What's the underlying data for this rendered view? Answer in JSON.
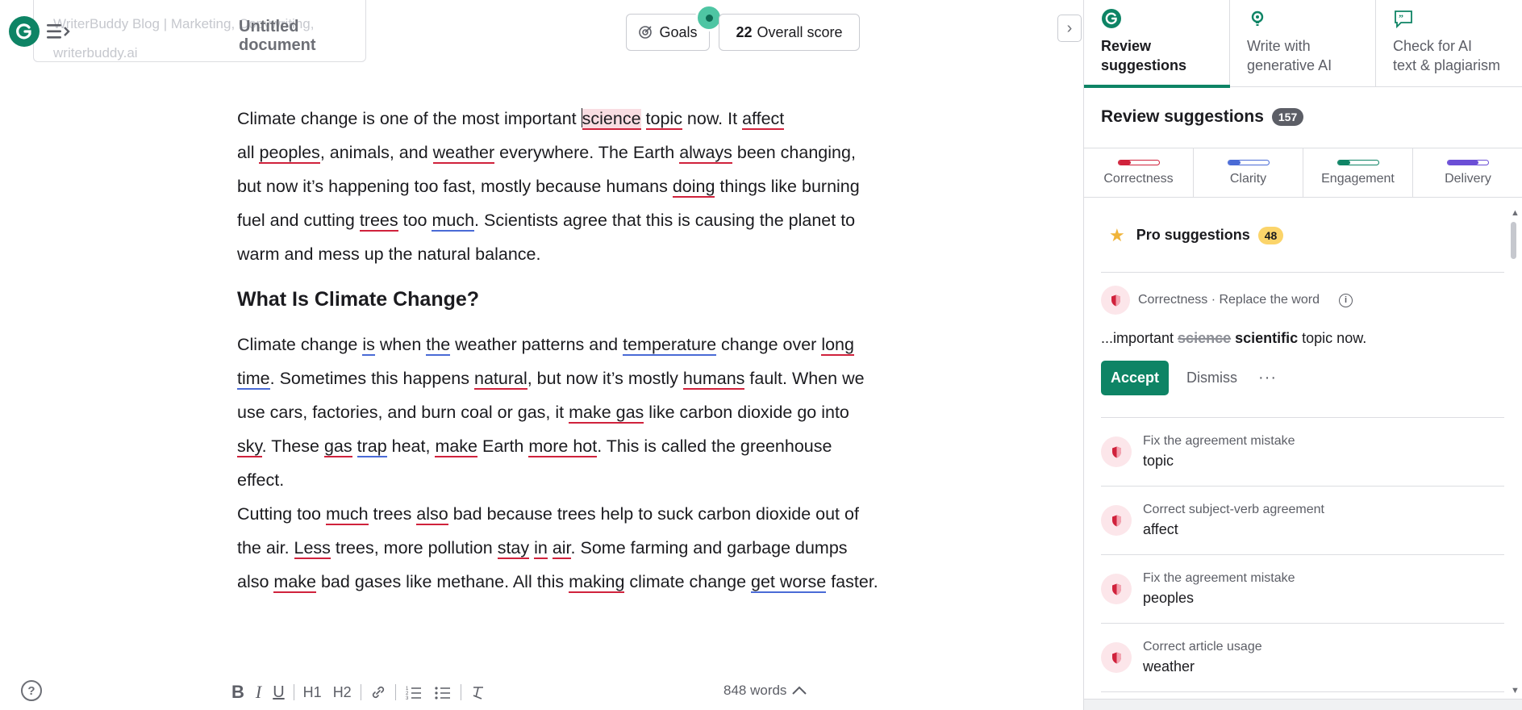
{
  "editor": {
    "doc_card_ghost_text": "WriterBuddy Blog | Marketing, Copywriting, writerbuddy.ai",
    "doc_title": "Untitled document",
    "goals_label": "Goals",
    "score_value": "22",
    "score_label": "Overall score",
    "word_count": "848 words"
  },
  "content": {
    "p1": {
      "a": "Climate change is one of the most important ",
      "science": "science",
      "topic": "topic",
      "b": " now. It ",
      "affect": "affect",
      "c": "all ",
      "peoples": "peoples",
      "d": ", animals, and ",
      "weather": "weather",
      "e": " everywhere. The Earth ",
      "always": "always",
      "f": " been changing, but now it’s happening too fast, mostly because humans ",
      "doing": "doing",
      "g": " things like burning fuel and cutting ",
      "trees": "trees",
      "h": " too ",
      "much": "much",
      "i": ". Scientists agree that this is causing the planet to warm and mess up the natural balance."
    },
    "heading": "What Is Climate Change?",
    "p2": {
      "a": "Climate change ",
      "is": "is",
      "b": " when ",
      "the": "the",
      "c": " weather patterns and ",
      "temperature": "temperature",
      "d": " change over ",
      "long": "long",
      "time": "time",
      "e": ". Sometimes this happens ",
      "natural": "natural",
      "f": ", but now it’s mostly ",
      "humans": "humans",
      "g": " fault. When we use cars, factories, and burn coal or gas, it ",
      "make1": "make gas",
      "h": " like carbon dioxide go into ",
      "sky": "sky",
      "i": ". These ",
      "gas": "gas",
      "trap": "trap",
      "j": " heat, ",
      "make2": "make",
      "k": " Earth ",
      "more": "more hot",
      "l": ". This is called the greenhouse effect."
    },
    "p3": {
      "a": "Cutting too ",
      "much": "much",
      "b": " trees ",
      "also": "also",
      "c": " bad because trees help to suck carbon dioxide out of the air. ",
      "less": "Less",
      "d": " trees, more pollution ",
      "stay": "stay",
      "in": "in",
      "air": "air",
      "e": ". Some farming and garbage dumps also ",
      "make": "make",
      "f": " bad gases like methane. All this ",
      "making": "making",
      "g": " climate change ",
      "getworse": "get worse",
      "h": " faster."
    }
  },
  "toolbar": {
    "bold": "B",
    "italic": "I",
    "underline": "U",
    "h1": "H1",
    "h2": "H2",
    "help": "?"
  },
  "panel": {
    "tabs": [
      {
        "label_line1": "Review",
        "label_line2": "suggestions",
        "icon": "grammarly-icon"
      },
      {
        "label_line1": "Write with",
        "label_line2": "generative AI",
        "icon": "bulb-icon"
      },
      {
        "label_line1": "Check for AI",
        "label_line2": "text & plagiarism",
        "icon": "quote-icon"
      }
    ],
    "title": "Review suggestions",
    "count": "157",
    "categories": [
      {
        "name": "Correctness",
        "color": "#d0223c",
        "fill": 0.3
      },
      {
        "name": "Clarity",
        "color": "#4a6bd6",
        "fill": 0.3
      },
      {
        "name": "Engagement",
        "color": "#0e8465",
        "fill": 0.3
      },
      {
        "name": "Delivery",
        "color": "#6b4ed6",
        "fill": 0.75
      }
    ],
    "pro": {
      "label": "Pro suggestions",
      "count": "48"
    },
    "active": {
      "category": "Correctness · Replace the word",
      "prefix": "...important ",
      "removed": "science",
      "added": "scientific",
      "suffix": " topic now.",
      "accept": "Accept",
      "dismiss": "Dismiss",
      "more": "···"
    },
    "suggestions": [
      {
        "kind": "Fix the agreement mistake",
        "word": "topic"
      },
      {
        "kind": "Correct subject-verb agreement",
        "word": "affect"
      },
      {
        "kind": "Fix the agreement mistake",
        "word": "peoples"
      },
      {
        "kind": "Correct article usage",
        "word": "weather"
      }
    ]
  },
  "colors": {
    "brand": "#0e8465",
    "correctness": "#d0223c",
    "clarity": "#4a6bd6"
  }
}
